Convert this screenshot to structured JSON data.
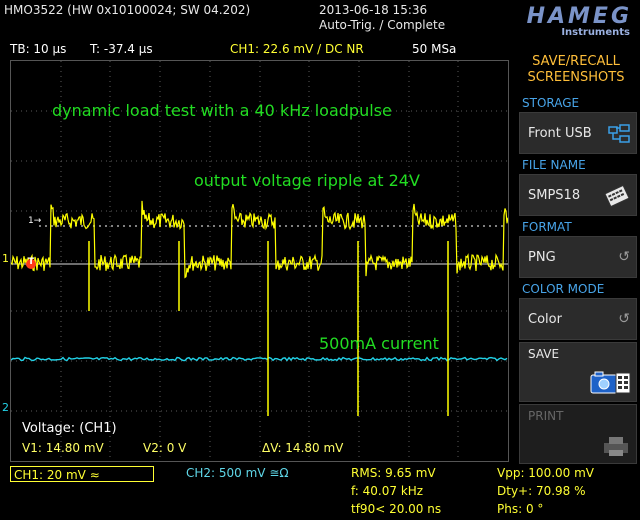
{
  "header": {
    "model": "HMO3522 (HW 0x10100024; SW 04.202)",
    "datetime": "2013-06-18 15:36",
    "trigger_status": "Auto-Trig. / Complete",
    "brand": "HAMEG",
    "brand_sub": "Instruments"
  },
  "status_bar": {
    "timebase": "TB: 10 µs",
    "trigger_time": "T: -37.4 µs",
    "ch1_trigger": "CH1: 22.6 mV / DC NR",
    "sample_rate": "50 MSa"
  },
  "annotations": {
    "line1": "dynamic load test with a 40 kHz loadpulse",
    "line2": "output voltage ripple at 24V",
    "line3": "500mA current"
  },
  "cursor": {
    "title": "Voltage: (CH1)",
    "v1": "V1: 14.80 mV",
    "v2": "V2: 0 V",
    "dv": "ΔV: 14.80 mV"
  },
  "markers": {
    "ch1": "1",
    "ch2": "2",
    "trigger": "T"
  },
  "bottom": {
    "ch1_scale": "CH1: 20 mV ≈",
    "ch2_scale": "CH2: 500 mV ≅Ω",
    "rms": "RMS: 9.65 mV",
    "freq": "f: 40.07 kHz",
    "fall": "tf90< 20.00 ns",
    "vpp": "Vpp: 100.00 mV",
    "duty": "Dty+: 70.98 %",
    "phase": "Phs: 0 °"
  },
  "menu": {
    "title": "SAVE/RECALL SCREENSHOTS",
    "storage_caption": "STORAGE",
    "storage_value": "Front USB",
    "filename_caption": "FILE NAME",
    "filename_value": "SMPS18",
    "format_caption": "FORMAT",
    "format_value": "PNG",
    "colormode_caption": "COLOR MODE",
    "colormode_value": "Color",
    "save_label": "SAVE",
    "print_label": "PRINT"
  },
  "colors": {
    "ch1_trace": "#ffff00",
    "ch2_trace": "#22d3e8",
    "annotation": "#22dd22",
    "menu_caption": "#48a4e8",
    "menu_title": "#ffbf3a"
  }
}
